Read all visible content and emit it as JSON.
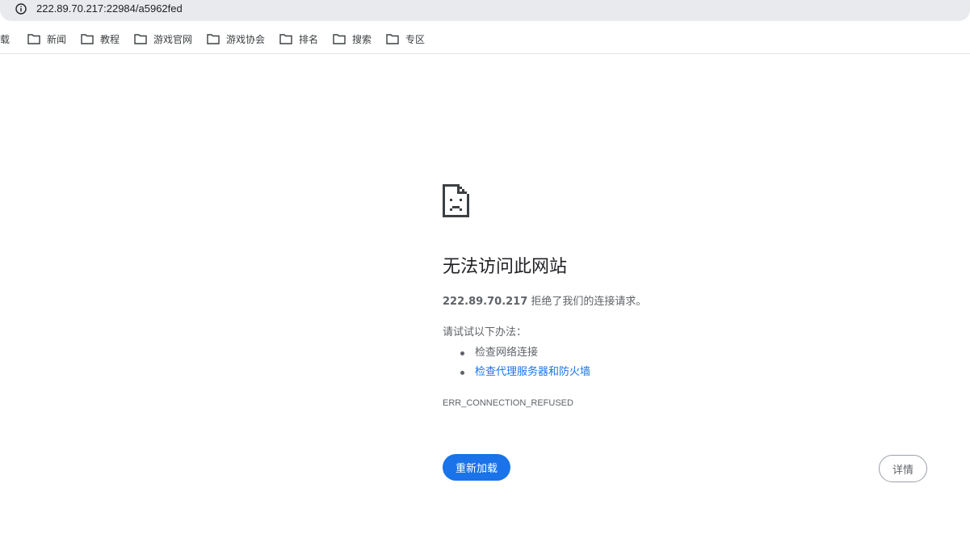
{
  "address_bar": {
    "url": "222.89.70.217:22984/a5962fed",
    "icon": "info-icon"
  },
  "bookmarks": [
    {
      "label": "下载",
      "icon": "folder-icon"
    },
    {
      "label": "新闻",
      "icon": "folder-icon"
    },
    {
      "label": "教程",
      "icon": "folder-icon"
    },
    {
      "label": "游戏官网",
      "icon": "folder-icon"
    },
    {
      "label": "游戏协会",
      "icon": "folder-icon"
    },
    {
      "label": "排名",
      "icon": "folder-icon"
    },
    {
      "label": "搜索",
      "icon": "folder-icon"
    },
    {
      "label": "专区",
      "icon": "folder-icon"
    }
  ],
  "error": {
    "icon": "sad-page-icon",
    "title": "无法访问此网站",
    "host": "222.89.70.217",
    "message": " 拒绝了我们的连接请求。",
    "try_label": "请试试以下办法：",
    "suggestions": [
      {
        "text": "检查网络连接",
        "link": false
      },
      {
        "text": "检查代理服务器和防火墙",
        "link": true
      }
    ],
    "code": "ERR_CONNECTION_REFUSED"
  },
  "buttons": {
    "reload": "重新加载",
    "details": "详情"
  },
  "colors": {
    "accent": "#1a73e8",
    "text_secondary": "#5f6368",
    "omnibox_bg": "#e8eaed"
  }
}
